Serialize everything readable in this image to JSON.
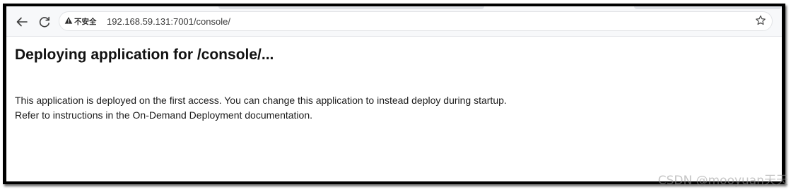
{
  "browser": {
    "back_icon": "arrow-left-icon",
    "reload_icon": "reload-icon",
    "security_icon": "warning-triangle-icon",
    "security_label": "不安全",
    "url": "192.168.59.131:7001/console/",
    "bookmark_icon": "star-outline-icon"
  },
  "page": {
    "heading": "Deploying application for /console/...",
    "line1": "This application is deployed on the first access. You can change this application to instead deploy during startup.",
    "line2": "Refer to instructions in the On-Demand Deployment documentation."
  },
  "watermark": "CSDN @mooyuan天天"
}
